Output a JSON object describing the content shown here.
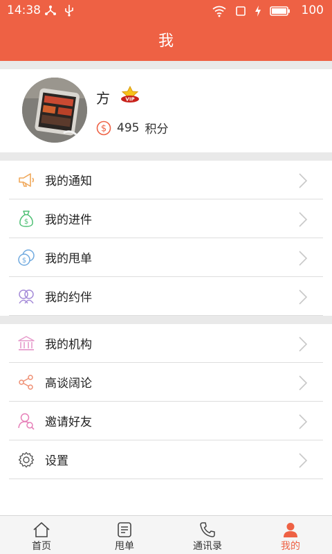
{
  "status_bar": {
    "time": "14:38",
    "battery": "100"
  },
  "header": {
    "title": "我"
  },
  "profile": {
    "name": "方",
    "points_value": "495",
    "points_unit": "积分"
  },
  "menu_group_1": [
    {
      "label": "我的通知",
      "icon": "megaphone-icon"
    },
    {
      "label": "我的进件",
      "icon": "money-bag-icon"
    },
    {
      "label": "我的甩单",
      "icon": "coins-icon"
    },
    {
      "label": "我的约伴",
      "icon": "companions-icon"
    }
  ],
  "menu_group_2": [
    {
      "label": "我的机构",
      "icon": "institution-icon"
    },
    {
      "label": "高谈阔论",
      "icon": "share-icon"
    },
    {
      "label": "邀请好友",
      "icon": "invite-friend-icon"
    },
    {
      "label": "设置",
      "icon": "gear-icon"
    }
  ],
  "tabs": [
    {
      "label": "首页",
      "icon": "home-icon"
    },
    {
      "label": "甩单",
      "icon": "order-icon"
    },
    {
      "label": "通讯录",
      "icon": "phone-icon"
    },
    {
      "label": "我的",
      "icon": "person-icon",
      "active": true
    }
  ],
  "colors": {
    "accent": "#ee6144",
    "background_gap": "#e9e9e9"
  }
}
